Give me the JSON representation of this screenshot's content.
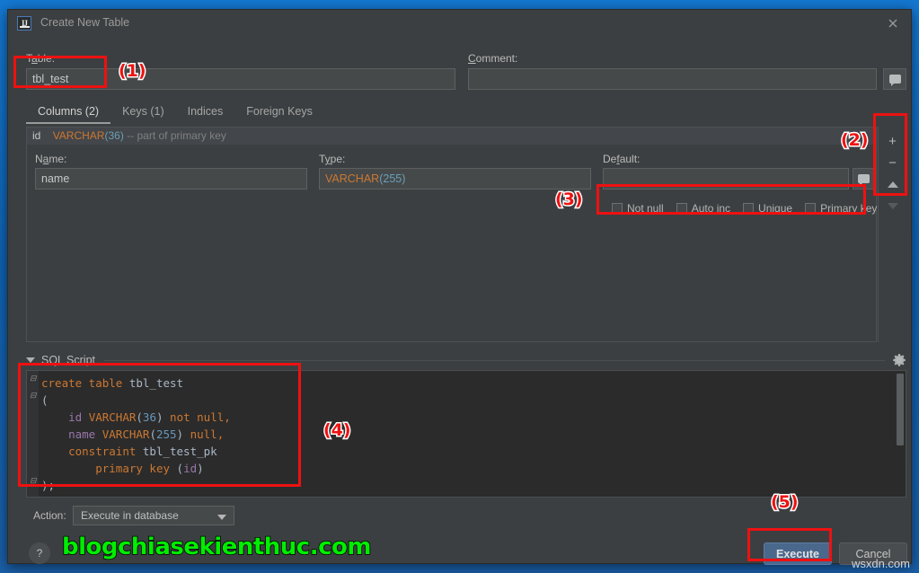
{
  "window": {
    "title": "Create New Table",
    "app_icon": "intellij-idea-icon",
    "close_icon": "close-icon"
  },
  "form": {
    "table_label": "Table:",
    "table_label_mnemonic": "a",
    "table_value": "tbl_test",
    "table_placeholder": "",
    "comment_label": "Comment:",
    "comment_value": "",
    "comment_placeholder": "",
    "comment_expand_icon": "expand-icon",
    "comment_button_icon": "comment-balloon-icon"
  },
  "tabs": [
    {
      "label": "Columns (2)",
      "active": true
    },
    {
      "label": "Keys (1)",
      "active": false
    },
    {
      "label": "Indices",
      "active": false
    },
    {
      "label": "Foreign Keys",
      "active": false
    }
  ],
  "column_row": {
    "name": "id",
    "type": "VARCHAR",
    "length": "(36)",
    "comment": "-- part of primary key"
  },
  "column_editor": {
    "name_label": "Name:",
    "name_value": "name",
    "type_label": "Type:",
    "type_value": "VARCHAR",
    "type_length": "(255)",
    "default_label": "Default:",
    "default_value": "",
    "default_button_icon": "comment-balloon-icon",
    "checkboxes": [
      {
        "label": "Not null",
        "checked": false
      },
      {
        "label": "Auto inc",
        "checked": false
      },
      {
        "label": "Unique",
        "checked": false
      },
      {
        "label": "Primary key",
        "checked": false
      }
    ]
  },
  "side_toolbar": [
    {
      "icon": "plus-icon",
      "label": "+"
    },
    {
      "icon": "minus-icon",
      "label": "−"
    },
    {
      "icon": "arrow-up-icon",
      "label": ""
    },
    {
      "icon": "arrow-down-icon",
      "label": ""
    }
  ],
  "sql_section": {
    "title": "SQL Script",
    "collapse_icon": "chevron-down-icon",
    "settings_icon": "gear-icon",
    "lines": [
      [
        {
          "t": "create",
          "c": "kw"
        },
        {
          "t": " table ",
          "c": "kw"
        },
        {
          "t": "tbl_test",
          "c": "id"
        }
      ],
      [
        {
          "t": "(",
          "c": "pl"
        }
      ],
      [
        {
          "t": "    ",
          "c": "pl"
        },
        {
          "t": "id",
          "c": "fn"
        },
        {
          "t": " ",
          "c": "pl"
        },
        {
          "t": "VARCHAR",
          "c": "kw"
        },
        {
          "t": "(",
          "c": "pl"
        },
        {
          "t": "36",
          "c": "num"
        },
        {
          "t": ")",
          "c": "pl"
        },
        {
          "t": " not null,",
          "c": "kw"
        }
      ],
      [
        {
          "t": "    ",
          "c": "pl"
        },
        {
          "t": "name",
          "c": "fn"
        },
        {
          "t": " ",
          "c": "pl"
        },
        {
          "t": "VARCHAR",
          "c": "kw"
        },
        {
          "t": "(",
          "c": "pl"
        },
        {
          "t": "255",
          "c": "num"
        },
        {
          "t": ")",
          "c": "pl"
        },
        {
          "t": " null,",
          "c": "kw"
        }
      ],
      [
        {
          "t": "    ",
          "c": "pl"
        },
        {
          "t": "constraint",
          "c": "kw"
        },
        {
          "t": " tbl_test_pk",
          "c": "id"
        }
      ],
      [
        {
          "t": "        ",
          "c": "pl"
        },
        {
          "t": "primary key",
          "c": "kw"
        },
        {
          "t": " (",
          "c": "pl"
        },
        {
          "t": "id",
          "c": "fn"
        },
        {
          "t": ")",
          "c": "pl"
        }
      ],
      [
        {
          "t": ");",
          "c": "pl"
        }
      ]
    ]
  },
  "footer": {
    "action_label": "Action:",
    "action_value": "Execute in database",
    "action_caret_icon": "chevron-down-icon",
    "help_label": "?",
    "execute_label": "Execute",
    "cancel_label": "Cancel"
  },
  "watermarks": {
    "blog": "blogchiasekienthuc.com",
    "corner": "wsxdn.com"
  },
  "annotations": [
    {
      "label": "(1)",
      "ref": "table-name-input"
    },
    {
      "label": "(2)",
      "ref": "side-toolbar"
    },
    {
      "label": "(3)",
      "ref": "column-flags"
    },
    {
      "label": "(4)",
      "ref": "sql-script"
    },
    {
      "label": "(5)",
      "ref": "execute-button"
    }
  ],
  "colors": {
    "accent": "#4a688c",
    "annotation": "#ee1111",
    "desktop": "#1478d2",
    "dialog_bg": "#3c3f41",
    "editor_bg": "#2b2b2b",
    "keyword": "#cc7832",
    "number": "#6897bb",
    "identifier": "#9876aa",
    "watermark_green": "#00ee00"
  }
}
